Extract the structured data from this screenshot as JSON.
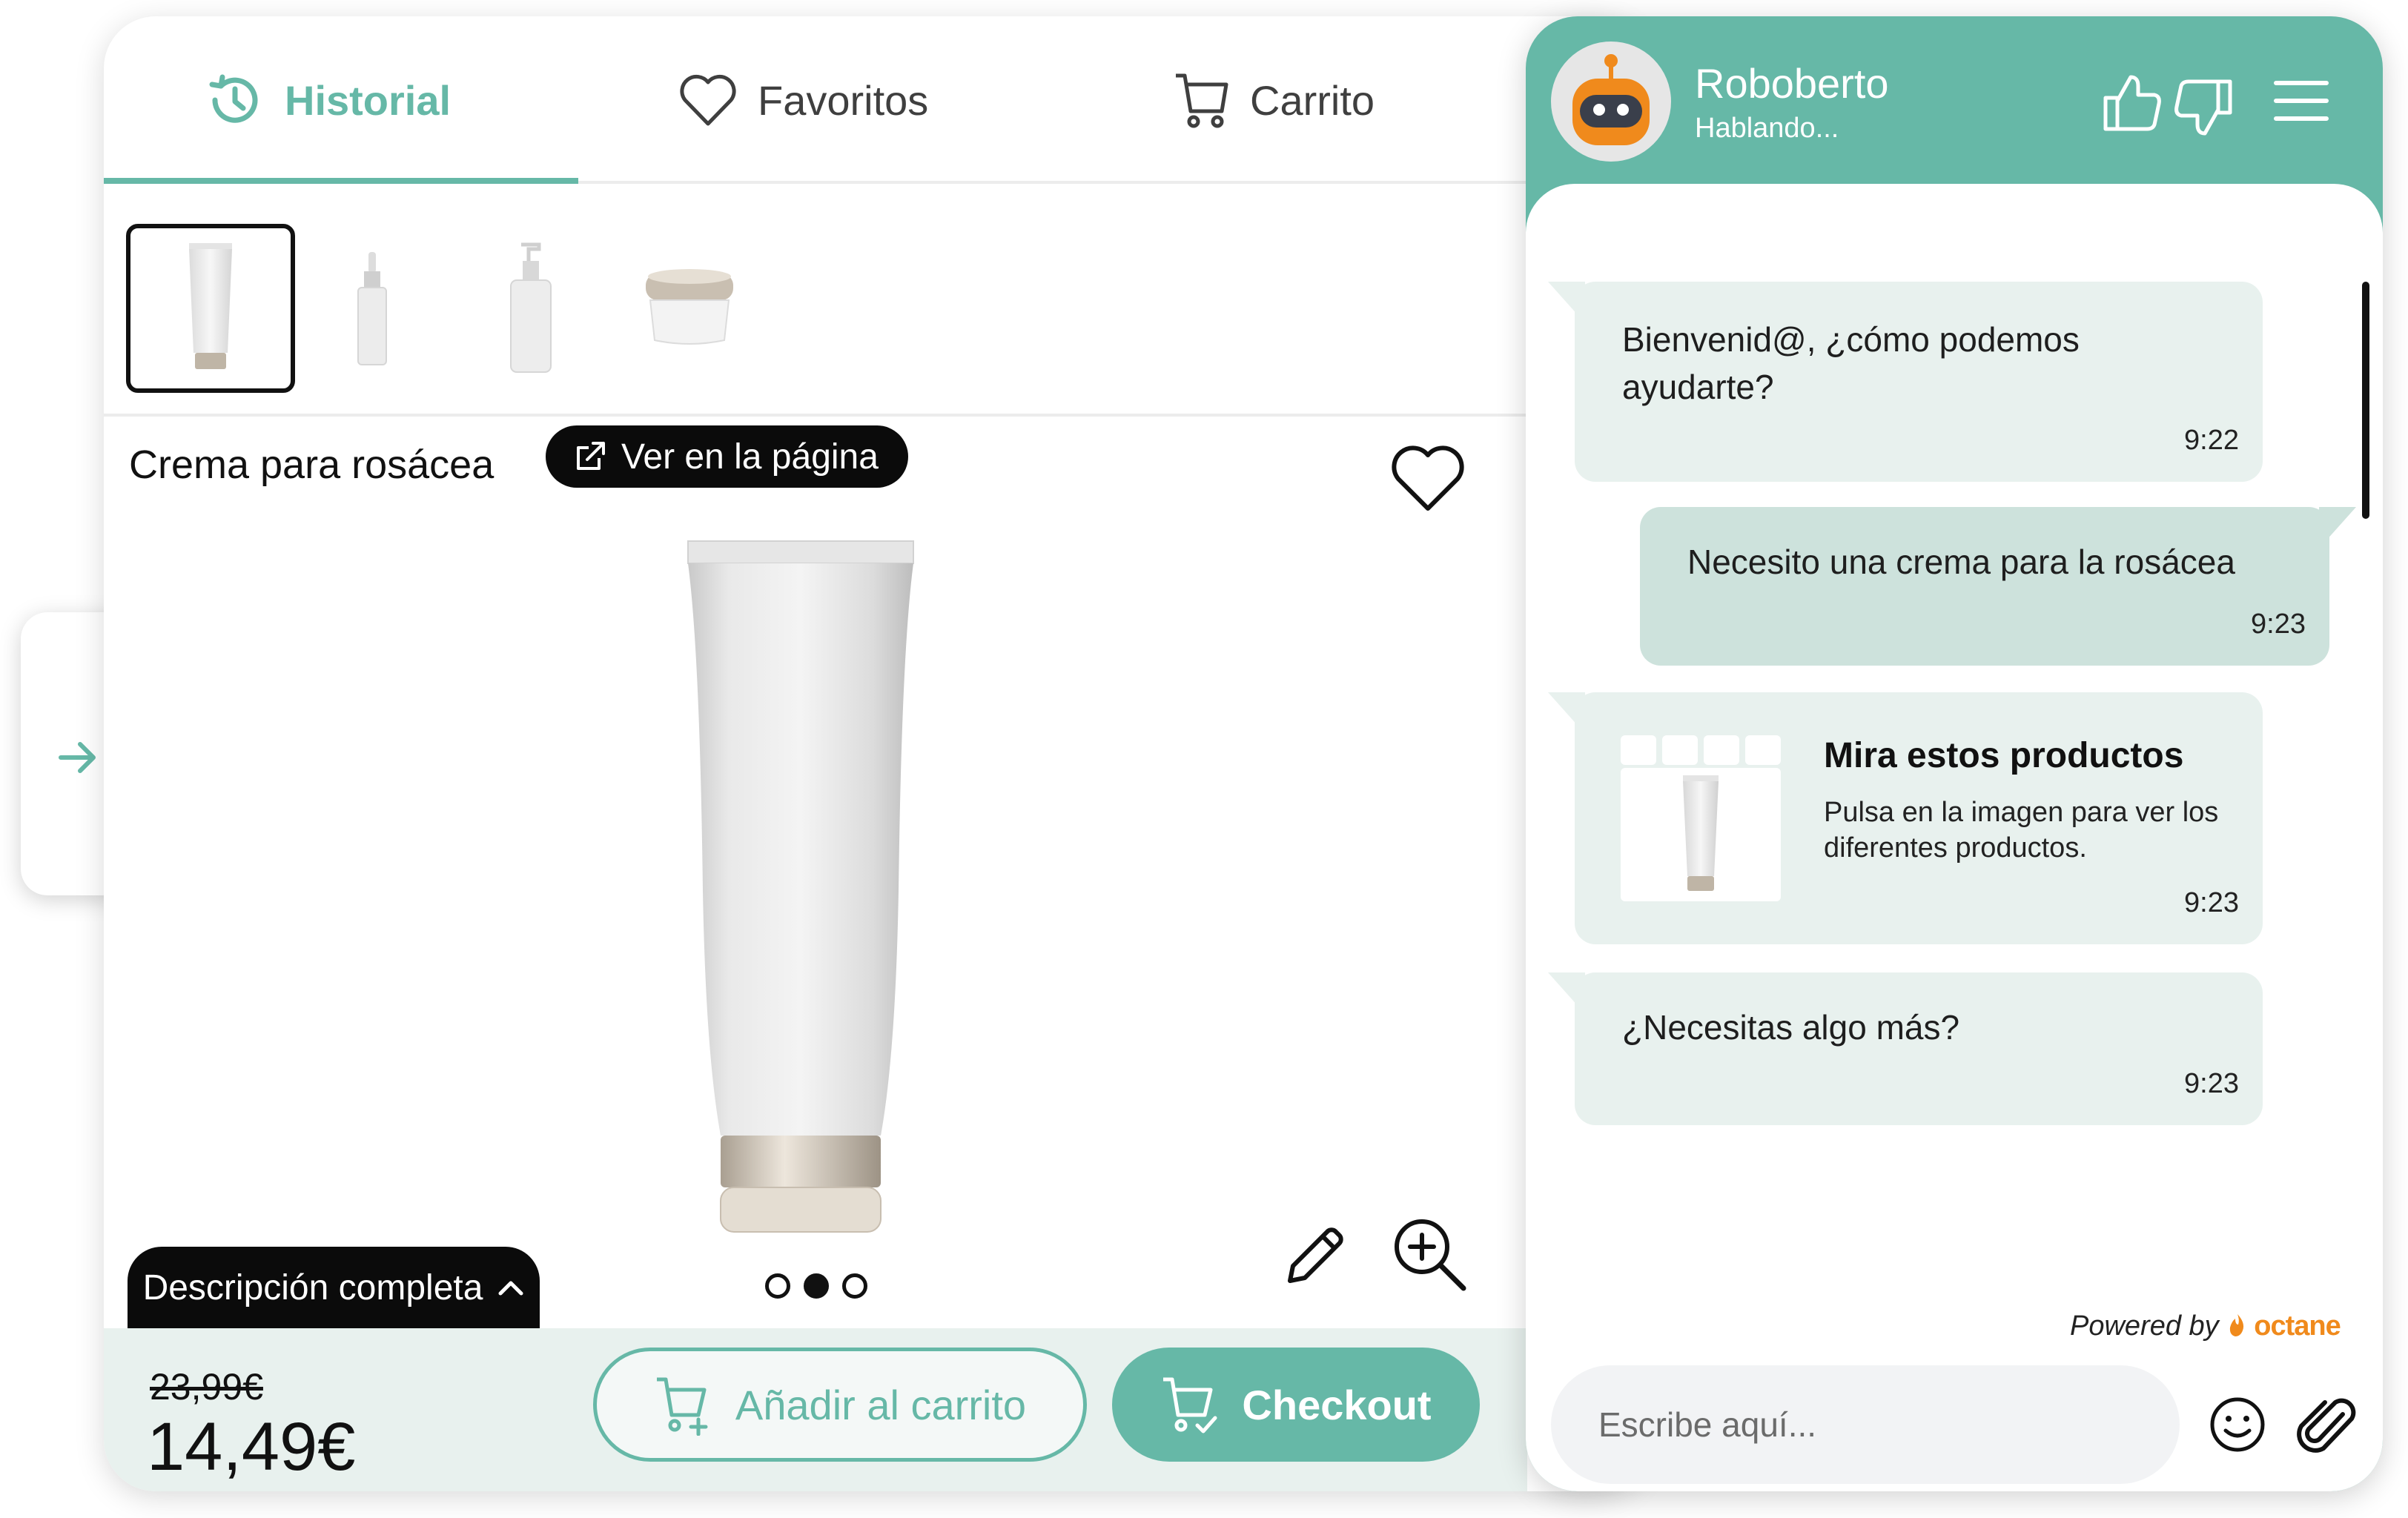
{
  "tabs": [
    {
      "label": "Historial",
      "icon": "history-icon",
      "active": true
    },
    {
      "label": "Favoritos",
      "icon": "heart-icon",
      "active": false
    },
    {
      "label": "Carrito",
      "icon": "cart-icon",
      "active": false
    }
  ],
  "thumbnails": [
    {
      "icon": "tube-thumbnail",
      "selected": true
    },
    {
      "icon": "dropper-bottle-thumbnail",
      "selected": false
    },
    {
      "icon": "pump-bottle-thumbnail",
      "selected": false
    },
    {
      "icon": "cream-jar-thumbnail",
      "selected": false
    }
  ],
  "product": {
    "title": "Crema para rosácea",
    "view_page_label": "Ver en la página",
    "description_label": "Descripción completa",
    "old_price": "23,99€",
    "price": "14,49€",
    "image_dots": 3,
    "active_dot": 2
  },
  "actions": {
    "add_to_cart_label": "Añadir al carrito",
    "checkout_label": "Checkout"
  },
  "chat": {
    "bot_name": "Roboberto",
    "status": "Hablando...",
    "messages": [
      {
        "from": "bot",
        "text": "Bienvenid@, ¿cómo podemos ayudarte?",
        "time": "9:22"
      },
      {
        "from": "user",
        "text": "Necesito una crema para la rosácea",
        "time": "9:23"
      },
      {
        "from": "bot",
        "type": "product_card",
        "title": "Mira estos productos",
        "subtitle": "Pulsa en la imagen para ver los diferentes productos.",
        "time": "9:23"
      },
      {
        "from": "bot",
        "text": "¿Necesitas algo más?",
        "time": "9:23"
      }
    ],
    "powered_by_label": "Powered by",
    "brand": "octane",
    "input_placeholder": "Escribe aquí..."
  },
  "colors": {
    "accent": "#66b8a7",
    "bubble_bot": "#e8f1ee",
    "bubble_user": "#cde2dc",
    "buy_bar": "#e8f1ee",
    "brand_orange": "#f08a1c"
  }
}
